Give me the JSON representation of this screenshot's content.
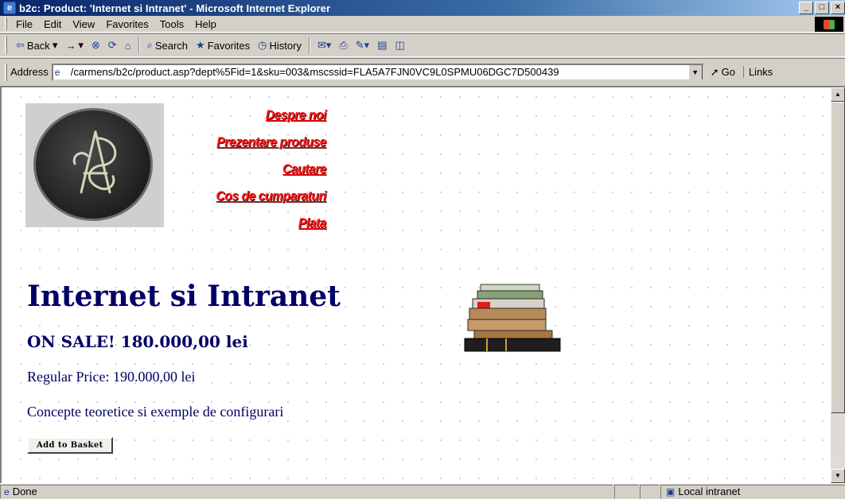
{
  "window": {
    "title": "b2c: Product: 'Internet si Intranet' - Microsoft Internet Explorer",
    "buttons": {
      "minimize": "_",
      "maximize": "□",
      "close": "×"
    }
  },
  "menu": [
    "File",
    "Edit",
    "View",
    "Favorites",
    "Tools",
    "Help"
  ],
  "toolbar": {
    "back": "Back",
    "forward": "→",
    "search": "Search",
    "favorites": "Favorites",
    "history": "History"
  },
  "address": {
    "label": "Address",
    "url": "/carmens/b2c/product.asp?dept%5Fid=1&sku=003&mscssid=FLA5A7FJN0VC9L0SPMU06DGC7D500439",
    "go": "Go",
    "links": "Links"
  },
  "nav": {
    "items": [
      "Despre noi",
      "Prezentare produse",
      "Cautare",
      "Cos de cumparaturi",
      "Plata"
    ]
  },
  "product": {
    "title": "Internet si Intranet",
    "sale": "ON SALE! 180.000,00 lei",
    "regular": "Regular Price: 190.000,00 lei",
    "description": "Concepte teoretice si exemple de configurari",
    "add_button": "Add to Basket"
  },
  "status": {
    "text": "Done",
    "zone": "Local intranet"
  },
  "colors": {
    "nav_link": "#ff1a1a",
    "product_text": "#000066"
  },
  "icons": [
    "ie-icon",
    "back-arrow-icon",
    "stop-icon",
    "refresh-icon",
    "home-icon",
    "search-icon",
    "favorites-icon",
    "history-icon",
    "mail-icon",
    "print-icon",
    "edit-icon",
    "page-icon",
    "go-icon",
    "zone-icon"
  ]
}
